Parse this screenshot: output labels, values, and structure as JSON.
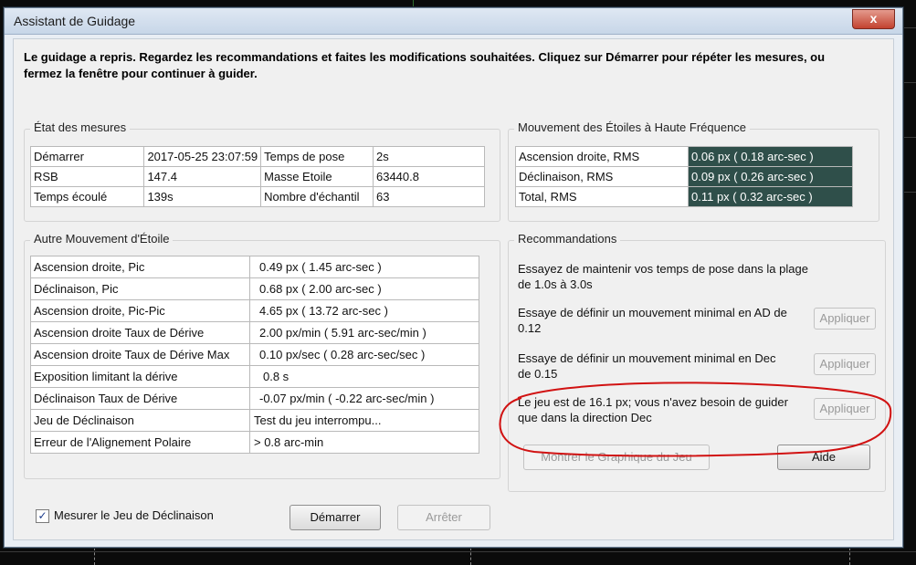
{
  "window": {
    "title": "Assistant de Guidage",
    "close_label": "x"
  },
  "intro": "Le guidage a repris. Regardez les recommandations et faites les modifications souhaitées. Cliquez sur Démarrer pour répéter les mesures, ou fermez la fenêtre pour continuer à guider.",
  "measurements": {
    "title": "État des mesures",
    "rows": [
      [
        "Démarrer",
        "2017-05-25 23:07:59",
        "Temps de pose",
        "2s"
      ],
      [
        "RSB",
        "147.4",
        "Masse Etoile",
        "63440.8"
      ],
      [
        "Temps écoulé",
        "139s",
        "Nombre d'échantil",
        "63"
      ]
    ]
  },
  "high_freq": {
    "title": "Mouvement des Étoiles à Haute Fréquence",
    "rows": [
      [
        "Ascension droite, RMS",
        "0.06 px ( 0.18 arc-sec )"
      ],
      [
        "Déclinaison, RMS",
        "0.09 px ( 0.26 arc-sec )"
      ],
      [
        "Total, RMS",
        "0.11 px ( 0.32 arc-sec )"
      ]
    ]
  },
  "other_motion": {
    "title": "Autre Mouvement d'Étoile",
    "rows": [
      [
        "Ascension droite, Pic",
        "0.49 px ( 1.45 arc-sec )"
      ],
      [
        "Déclinaison, Pic",
        "0.68 px ( 2.00 arc-sec )"
      ],
      [
        "Ascension droite, Pic-Pic",
        "4.65 px ( 13.72 arc-sec )"
      ],
      [
        "Ascension droite Taux de Dérive",
        "2.00 px/min ( 5.91 arc-sec/min )"
      ],
      [
        "Ascension droite Taux de Dérive Max",
        "0.10 px/sec ( 0.28 arc-sec/sec )"
      ],
      [
        "Exposition limitant la dérive",
        "0.8 s"
      ],
      [
        "Déclinaison Taux de Dérive",
        "-0.07 px/min ( -0.22 arc-sec/min )"
      ],
      [
        "Jeu de Déclinaison",
        "Test du jeu interrompu..."
      ],
      [
        "Erreur de l'Alignement Polaire",
        "> 0.8 arc-min"
      ]
    ]
  },
  "recommendations": {
    "title": "Recommandations",
    "items": [
      {
        "text": "Essayez de maintenir vos temps de pose dans la plage de 1.0s à 3.0s"
      },
      {
        "text": "Essaye de définir un mouvement minimal en AD de 0.12",
        "button": "Appliquer"
      },
      {
        "text": "Essaye de définir un mouvement minimal en Dec de 0.15",
        "button": "Appliquer"
      },
      {
        "text": "Le jeu est de 16.1 px; vous n'avez besoin de guider que dans la direction Dec",
        "button": "Appliquer"
      }
    ],
    "show_graph_label": "Montrer le Graphique du Jeu",
    "help_label": "Aide"
  },
  "footer": {
    "checkbox_label": "Mesurer le Jeu de Déclinaison",
    "checkbox_checked": true,
    "start_label": "Démarrer",
    "stop_label": "Arrêter"
  },
  "colors": {
    "highlight_cell": "#2f4f4a",
    "annotation": "#d11212"
  }
}
